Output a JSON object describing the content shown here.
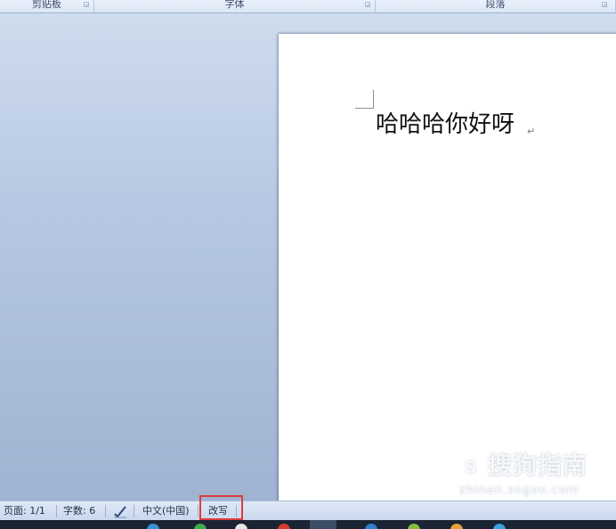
{
  "ribbon": {
    "groups": [
      {
        "label": "剪贴板"
      },
      {
        "label": "字体"
      },
      {
        "label": "段落"
      }
    ]
  },
  "document": {
    "text": "哈哈哈你好呀",
    "paragraph_mark": "↵"
  },
  "watermark": {
    "title": "搜狗指南",
    "url": "zhinan.sogou.com"
  },
  "status_bar": {
    "page": "页面: 1/1",
    "word_count": "字数: 6",
    "language": "中文(中国)",
    "mode": "改写"
  },
  "colors": {
    "highlight_box": "#e03b3b",
    "workspace_top": "#cfdcee",
    "workspace_bottom": "#9fb3d2",
    "taskbar": "#1b2433"
  },
  "icons": {
    "ribbon_launcher": "dialog-launcher-icon",
    "proofing": "proofing-check-icon",
    "watermark_logo": "sogou-logo-icon"
  }
}
